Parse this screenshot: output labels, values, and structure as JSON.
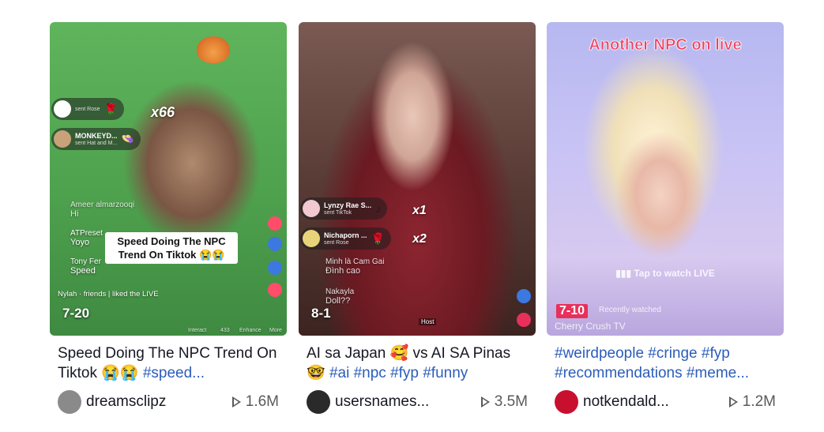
{
  "cards": [
    {
      "overlay": {
        "counter": "7-20",
        "caption": "Speed Doing The NPC Trend On Tiktok 😭😭",
        "multiplier": "x66",
        "gift1_name": "",
        "gift1_sub": "sent Rose",
        "gift2_name": "MONKEYD...",
        "gift2_sub": "sent Hat and M...",
        "comment1_name": "Ameer almarzooqi",
        "comment1_text": "Hi",
        "comment2_name": "ATPreset",
        "comment2_text": "Yoyo",
        "comment3_name": "Tony Fer",
        "comment3_text": "Speed",
        "liked": "Nylah · friends | liked the LIVE",
        "bottom_labels": [
          "Interact",
          "433",
          "Enhance",
          "More"
        ]
      },
      "desc_text": "Speed Doing The NPC Trend On Tiktok 😭😭 ",
      "desc_tag": "#speed...",
      "username": "dreamsclipz",
      "views": "1.6M",
      "avatar_color": "#8a8a8a"
    },
    {
      "overlay": {
        "counter": "8-1",
        "gift1_name": "Lynzy Rae S...",
        "gift1_sub": "sent TikTok",
        "mult1": "x1",
        "gift2_name": "Nichaporn ...",
        "gift2_sub": "sent Rose",
        "mult2": "x2",
        "comment1_name": "Minh là Cam Gai",
        "comment1_text": "Đình cao",
        "comment2_name": "Nakayla",
        "comment2_text": "Doll??",
        "host": "Host"
      },
      "desc_text": "AI sa Japan 🥰 vs AI SA Pinas 🤓 ",
      "desc_tag": "#ai #npc #fyp #funny",
      "username": "usersnames...",
      "views": "3.5M",
      "avatar_color": "#2a2a2a"
    },
    {
      "overlay": {
        "banner": "Another NPC on live",
        "tap": "Tap to watch LIVE",
        "badge": "7-10",
        "recent": "Recently watched",
        "channel": "Cherry Crush TV"
      },
      "desc_text": "",
      "desc_tag": "#weirdpeople #cringe #fyp #recommendations #meme...",
      "username": "notkendald...",
      "views": "1.2M",
      "avatar_color": "#c8102e"
    }
  ],
  "icons": {
    "play": "play-icon",
    "heart": "heart-icon",
    "share": "share-icon"
  }
}
